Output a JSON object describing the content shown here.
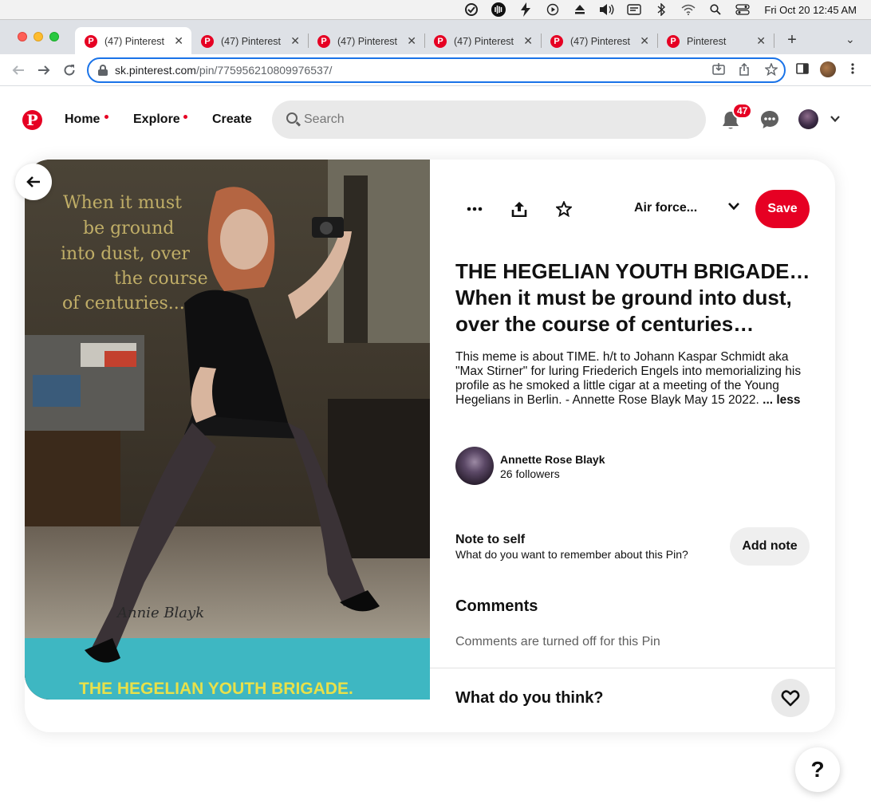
{
  "menubar": {
    "icons": [
      "sync-check-icon",
      "audio-waves-icon",
      "bolt-icon",
      "play-circle-icon",
      "eject-icon",
      "volume-icon",
      "display-icon",
      "bluetooth-icon",
      "wifi-icon",
      "spotlight-search-icon",
      "control-center-icon"
    ],
    "datetime": "Fri Oct 20  12:45 AM"
  },
  "browser": {
    "tabs": [
      {
        "title": "(47) Pinterest",
        "active": true
      },
      {
        "title": "(47) Pinterest",
        "active": false
      },
      {
        "title": "(47) Pinterest",
        "active": false
      },
      {
        "title": "(47) Pinterest",
        "active": false
      },
      {
        "title": "(47) Pinterest",
        "active": false
      },
      {
        "title": "Pinterest",
        "active": false
      }
    ],
    "url_host": "sk.pinterest.com",
    "url_path": "/pin/775956210809976537/"
  },
  "header": {
    "logo": "P",
    "nav": [
      {
        "label": "Home",
        "dot": true
      },
      {
        "label": "Explore",
        "dot": true
      },
      {
        "label": "Create",
        "dot": false
      }
    ],
    "search_placeholder": "Search",
    "notifications_count": "47",
    "brand_color": "#e60023"
  },
  "pin": {
    "board": "Air force...",
    "save_label": "Save",
    "title": "THE HEGELIAN YOUTH BRIGADE… When it must be ground into dust, over the course of centuries…",
    "description": "This meme is about TIME. h/t to Johann Kaspar Schmidt aka \"Max Stirner\" for luring Friederich Engels into memorializing his profile as he smoked a little cigar at a meeting of the Young Hegelians in Berlin. - Annette Rose Blayk May 15 2022.",
    "less_label": "... less",
    "image": {
      "overlay_lines": [
        "When it must",
        "be ground",
        "into dust, over",
        "the course",
        "of centuries..."
      ],
      "signature": "Annie Blayk",
      "caption": "THE HEGELIAN YOUTH BRIGADE."
    },
    "creator": {
      "name": "Annette Rose Blayk",
      "followers": "26 followers"
    },
    "note": {
      "title": "Note to self",
      "subtitle": "What do you want to remember about this Pin?",
      "button": "Add note"
    },
    "comments": {
      "title": "Comments",
      "status": "Comments are turned off for this Pin"
    },
    "feedback_prompt": "What do you think?"
  },
  "help_label": "?"
}
